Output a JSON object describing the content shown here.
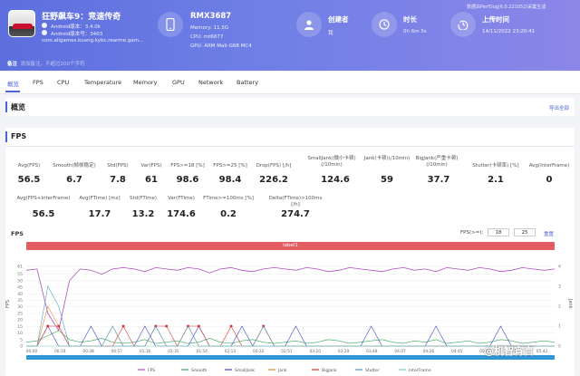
{
  "app": {
    "title": "狂野飙车9：竞速传奇",
    "android_version_line": "Android版本：3.4.0k",
    "android_code_line": "Android版本号：3403",
    "package": "com.aligames.kuang.kybc.rearme.gam..."
  },
  "device": {
    "name": "RMX3687",
    "memory": "Memory: 11.5G",
    "cpu": "CPU: mt6877",
    "gpu": "GPU: ARM Mali-G68 MC4"
  },
  "creator": {
    "title": "创建者",
    "value": "我"
  },
  "duration": {
    "title": "时长",
    "value": "0h 6m 5s"
  },
  "upload": {
    "title": "上传时间",
    "value": "14/11/2022 23:20:41"
  },
  "brand": "数据由PerfDog(6.0.221052)采集生成",
  "note": {
    "label": "备注",
    "value": "添加备注，不超过200个字符"
  },
  "tabs": [
    "概览",
    "FPS",
    "CPU",
    "Temperature",
    "Memory",
    "GPU",
    "Network",
    "Battery"
  ],
  "overview": {
    "title": "概览",
    "export": "导出全部"
  },
  "fps_section": {
    "title": "FPS"
  },
  "metrics_row1": [
    {
      "label": "Avg(FPS)",
      "value": "56.5"
    },
    {
      "label": "Smooth(帧帧稳定)",
      "value": "6.7"
    },
    {
      "label": "Std(FPS)",
      "value": "7.8"
    },
    {
      "label": "Var(FPS)",
      "value": "61"
    },
    {
      "label": "FPS>=18 [%]",
      "value": "98.6"
    },
    {
      "label": "FPS>=25 [%]",
      "value": "98.4"
    },
    {
      "label": "Drop(FPS) [/h]",
      "value": "226.2"
    },
    {
      "label": "SmallJank(微小卡顿)(/10min)",
      "value": "124.6"
    },
    {
      "label": "Jank(卡顿)(/10min)",
      "value": "59"
    },
    {
      "label": "BigJank(严重卡顿)(/10min)",
      "value": "37.7"
    },
    {
      "label": "Stutter(卡顿率) [%]",
      "value": "2.1"
    },
    {
      "label": "Avg(InterFrame)",
      "value": "0"
    }
  ],
  "metrics_row2": [
    {
      "label": "Avg(FPS+InterFrame)",
      "value": "56.5"
    },
    {
      "label": "Avg(FTime) [ms]",
      "value": "17.7"
    },
    {
      "label": "Std(FTime)",
      "value": "13.2"
    },
    {
      "label": "Var(FTime)",
      "value": "174.6"
    },
    {
      "label": "FTime>=100ms [%]",
      "value": "0.2"
    },
    {
      "label": "Delta(FTime)>100ms [/h]",
      "value": "274.7"
    }
  ],
  "chart_controls": {
    "title": "FPS",
    "fps_label": "FPS(>=):",
    "threshold1": "18",
    "threshold2": "25",
    "reset": "重置",
    "label_bar": "label1"
  },
  "watermark": "@机智宵言",
  "colors": {
    "header_start": "#5d6fde",
    "header_end": "#8c86e8",
    "accent": "#4a63d9",
    "label_bar": "#e25c62"
  },
  "chart_data": {
    "type": "line",
    "ylabel": "FPS",
    "ylabel_right": "Jank",
    "yticks": [
      0,
      5,
      10,
      15,
      20,
      25,
      30,
      35,
      40,
      45,
      50,
      55,
      61
    ],
    "yticks_right": [
      0,
      1,
      2,
      3,
      4
    ],
    "xticks": [
      "00:00",
      "00:19",
      "00:38",
      "00:57",
      "01:16",
      "01:35",
      "01:54",
      "02:13",
      "02:32",
      "02:51",
      "03:10",
      "03:29",
      "03:48",
      "04:07",
      "04:26",
      "04:45",
      "05:04",
      "05:23",
      "05:42"
    ],
    "series": [
      {
        "name": "FPS",
        "color": "#b04fc0",
        "values": [
          58,
          59,
          25,
          12,
          50,
          59,
          58,
          55,
          59,
          60,
          59,
          57,
          60,
          59,
          58,
          60,
          59,
          56,
          59,
          60,
          58,
          57,
          59,
          60,
          59,
          58,
          60,
          59,
          57,
          58,
          60,
          59,
          58,
          57,
          59,
          60,
          58,
          59,
          57,
          60,
          59,
          58,
          60,
          59,
          57,
          58,
          60,
          59,
          58,
          59
        ]
      },
      {
        "name": "Smooth",
        "color": "#3da35d",
        "values": [
          3,
          4,
          8,
          12,
          5,
          3,
          4,
          6,
          3,
          2,
          3,
          5,
          2,
          3,
          4,
          2,
          3,
          6,
          3,
          2,
          4,
          5,
          3,
          2,
          3,
          4,
          2,
          3,
          5,
          4,
          2,
          3,
          4,
          5,
          3,
          2,
          4,
          3,
          5,
          2,
          3,
          4,
          2,
          3,
          5,
          4,
          2,
          3,
          4,
          3
        ]
      },
      {
        "name": "SmallJank",
        "color": "#3a45c8",
        "values": [
          0,
          0,
          1,
          0,
          0,
          0,
          1,
          0,
          0,
          0,
          0,
          1,
          0,
          0,
          0,
          0,
          1,
          0,
          0,
          0,
          1,
          0,
          0,
          0,
          0,
          1,
          0,
          0,
          0,
          0,
          0,
          0,
          1,
          0,
          0,
          0,
          0,
          0,
          1,
          0,
          0,
          0,
          0,
          0,
          1,
          0,
          0,
          0,
          0,
          0
        ]
      },
      {
        "name": "Jank",
        "color": "#e08a2e",
        "values": [
          0,
          0,
          2,
          1,
          0,
          0,
          0,
          0,
          1,
          0,
          0,
          0,
          1,
          0,
          0,
          1,
          0,
          0,
          0,
          0,
          0,
          0,
          1,
          0,
          0,
          0,
          0,
          0,
          0,
          0,
          0,
          0,
          0,
          0,
          0,
          0,
          0,
          0,
          0,
          0,
          0,
          0,
          0,
          0,
          0,
          0,
          0,
          0,
          0,
          0
        ]
      },
      {
        "name": "BigJank",
        "color": "#d63a3a",
        "values": [
          0,
          0,
          1,
          1,
          0,
          0,
          0,
          0,
          0,
          1,
          0,
          0,
          1,
          1,
          0,
          1,
          1,
          0,
          0,
          1,
          0,
          0,
          1,
          0,
          0,
          0,
          0,
          0,
          0,
          0,
          0,
          0,
          0,
          0,
          0,
          0,
          0,
          0,
          0,
          0,
          0,
          0,
          0,
          0,
          0,
          0,
          0,
          0,
          0,
          0
        ]
      },
      {
        "name": "Stutter",
        "color": "#4aa3c8",
        "values": [
          0,
          0,
          3,
          2,
          0,
          0,
          0,
          0,
          1,
          0,
          0,
          0,
          1,
          0,
          0,
          1,
          0,
          0,
          0,
          0,
          0,
          0,
          1,
          0,
          0,
          0,
          0,
          0,
          0,
          0,
          0,
          0,
          0,
          0,
          0,
          0,
          0,
          0,
          0,
          0,
          0,
          0,
          0,
          0,
          0,
          0,
          0,
          0,
          0,
          0
        ]
      },
      {
        "name": "InterFrame",
        "color": "#7fd3c8",
        "values": [
          0,
          0,
          0,
          0,
          0,
          0,
          0,
          0,
          0,
          0,
          0,
          0,
          0,
          0,
          0,
          0,
          0,
          0,
          0,
          0,
          0,
          0,
          0,
          0,
          0,
          0,
          0,
          0,
          0,
          0,
          0,
          0,
          0,
          0,
          0,
          0,
          0,
          0,
          0,
          0,
          0,
          0,
          0,
          0,
          0,
          0,
          0,
          0,
          0,
          0
        ]
      }
    ],
    "ylim": [
      0,
      61
    ],
    "ylim_right": [
      0,
      4
    ]
  }
}
